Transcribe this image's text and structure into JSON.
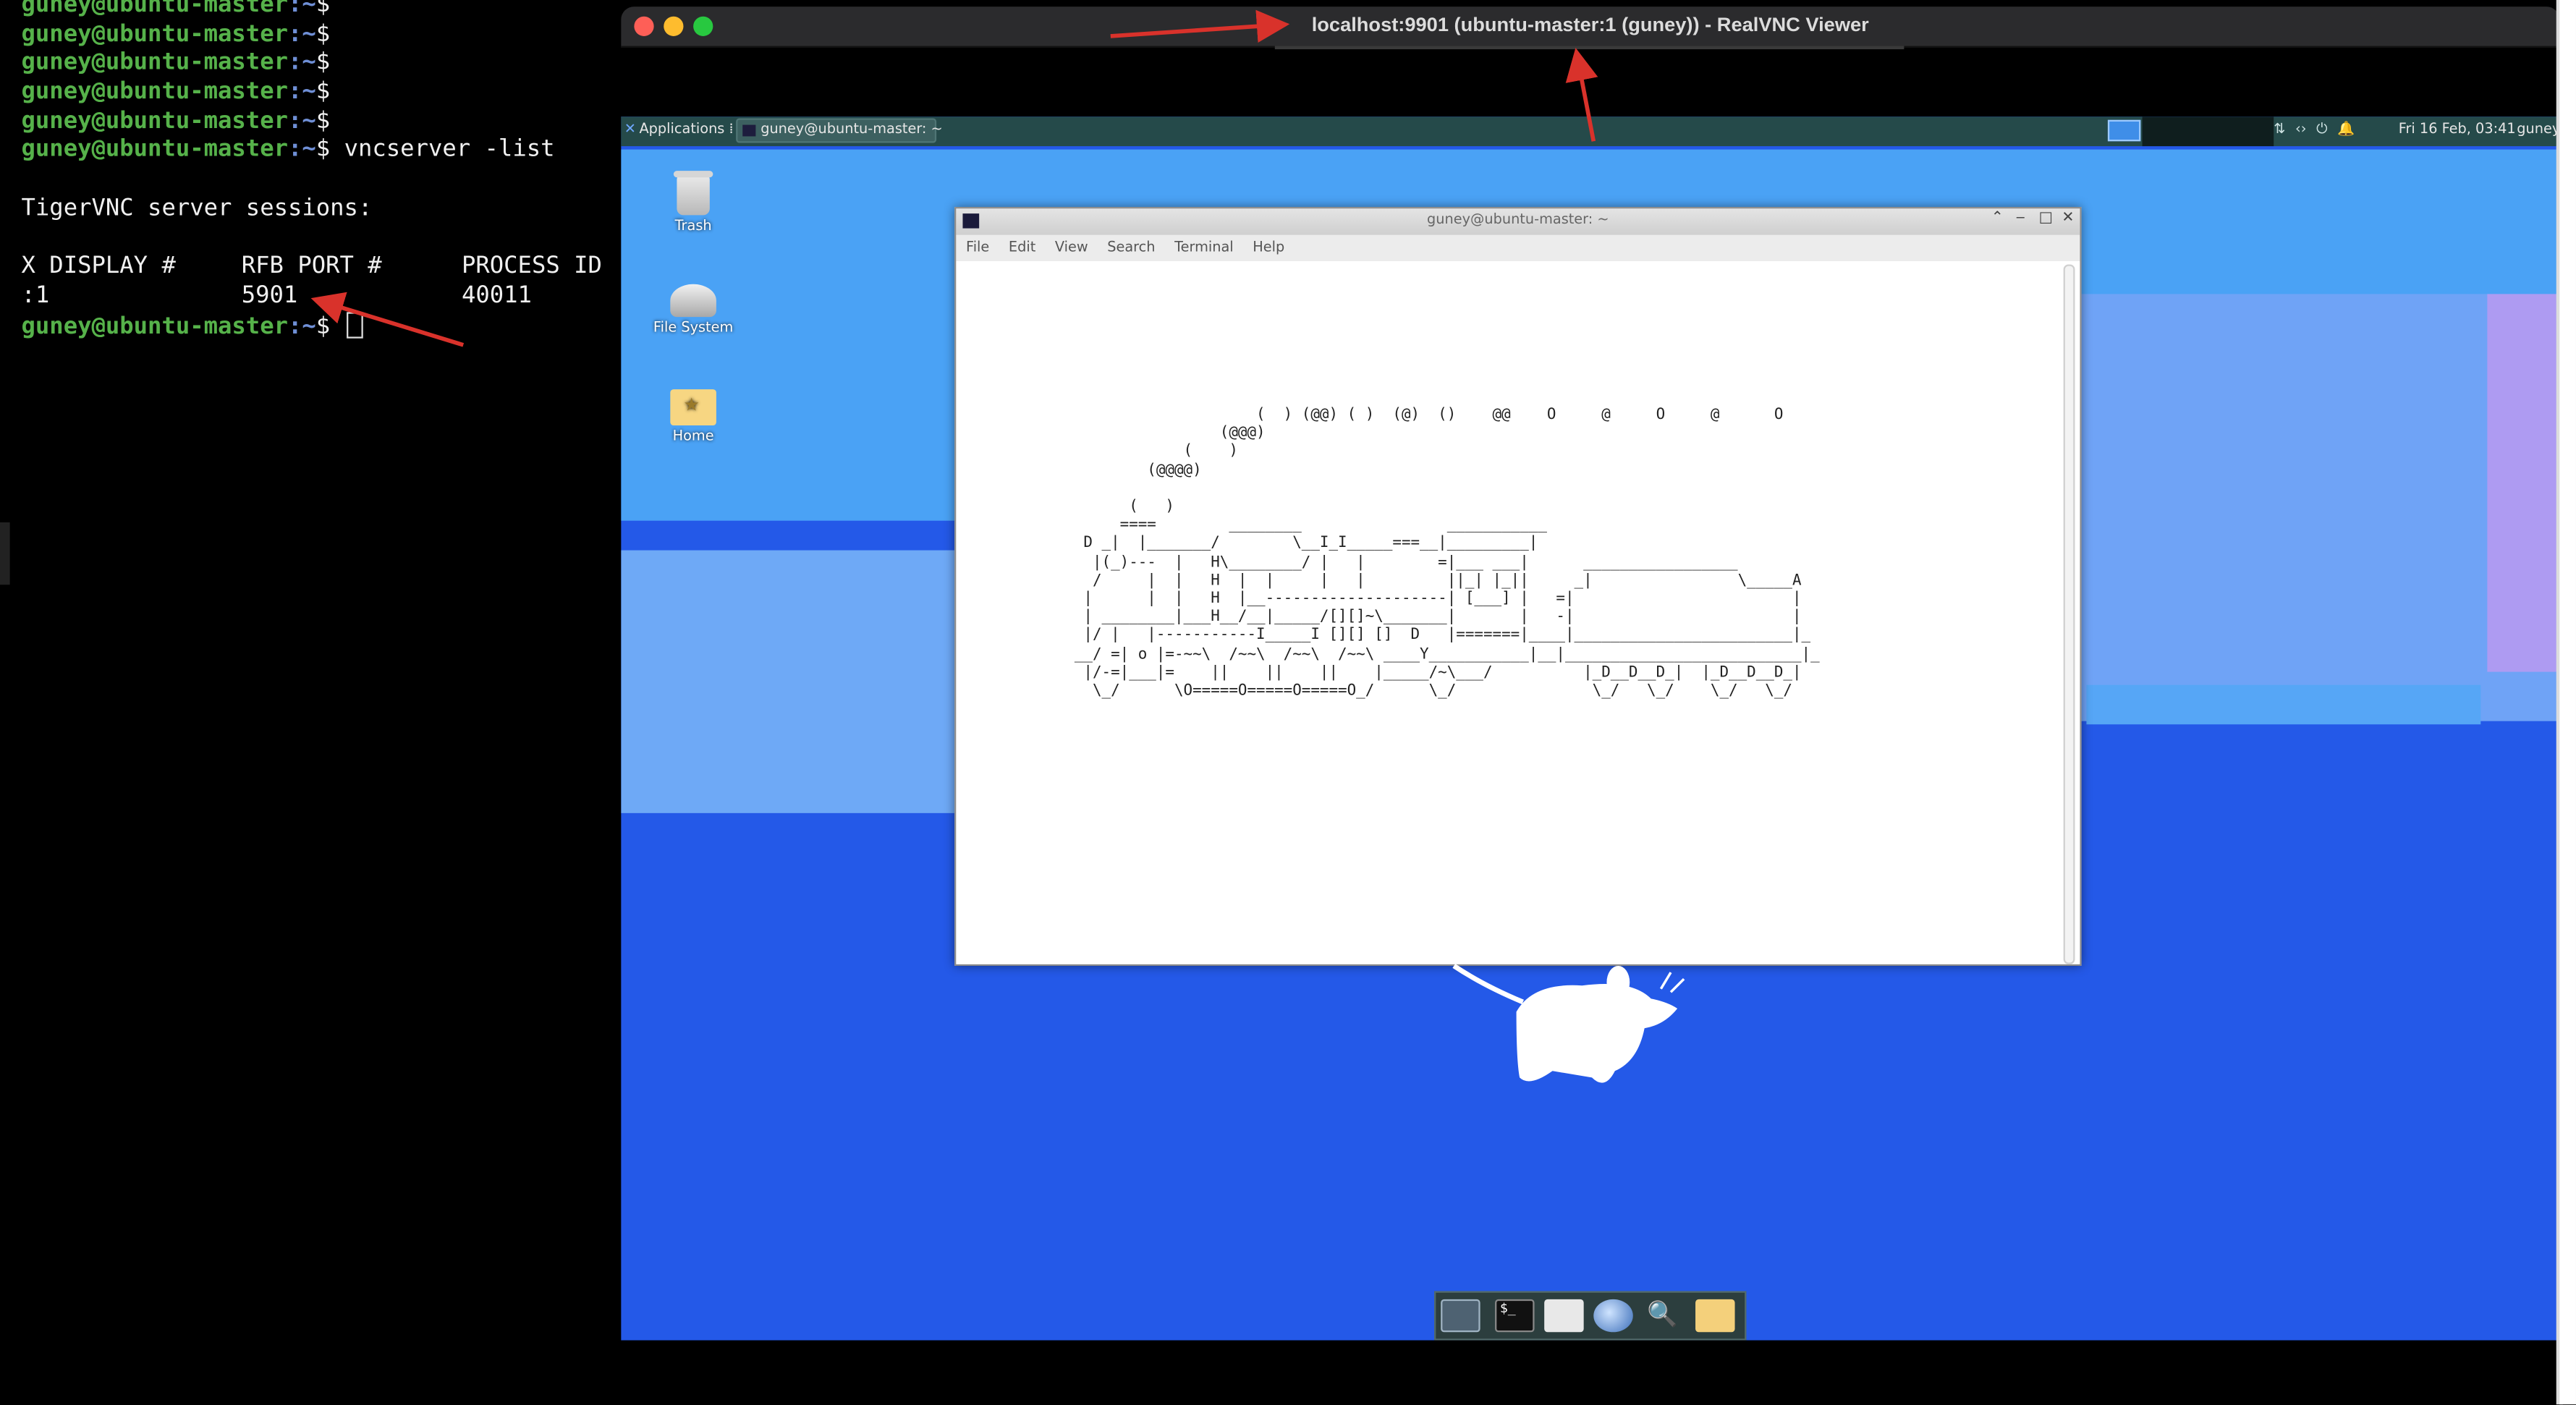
{
  "host_terminal": {
    "prompt_user": "guney@ubuntu-master",
    "prompt_path": ":~",
    "prompt_symbol": "$",
    "command": "vncserver -list",
    "sessions_heading": "TigerVNC server sessions:",
    "col_display": "X DISPLAY #",
    "col_port": "RFB PORT #",
    "col_pid": "PROCESS ID",
    "row_display": ":1",
    "row_port": "5901",
    "row_pid": "40011"
  },
  "vnc_viewer": {
    "title": "localhost:9901 (ubuntu-master:1 (guney)) - RealVNC Viewer",
    "panel": {
      "applications_label": "Applications",
      "task_label": "guney@ubuntu-master: ~",
      "clock": "Fri 16 Feb, 03:41",
      "user": "guney"
    },
    "desktop_icons": [
      "Trash",
      "File System",
      "Home"
    ],
    "terminal": {
      "title": "guney@ubuntu-master: ~",
      "menu": [
        "File",
        "Edit",
        "View",
        "Search",
        "Terminal",
        "Help"
      ],
      "art": "                    (  ) (@@) ( )  (@)  ()    @@    O     @     O     @      O\n                (@@@)\n            (    )\n        (@@@@)\n\n      (   )\n     ====        ________                ___________\n D _|  |_______/        \\__I_I_____===__|_________|\n  |(_)---  |   H\\________/ |   |        =|___ ___|      _________________\n  /     |  |   H  |  |     |   |         ||_| |_||     _|                \\_____A\n |      |  |   H  |__--------------------| [___] |   =|                        |\n | ________|___H__/__|_____/[][]~\\_______|       |   -|                        |\n |/ |   |-----------I_____I [][] []  D   |=======|____|________________________|_\n__/ =| o |=-~~\\  /~~\\  /~~\\  /~~\\ ____Y___________|__|__________________________|_\n |/-=|___|=    ||    ||    ||    |_____/~\\___/          |_D__D__D_|  |_D__D__D_|\n  \\_/      \\O=====O=====O=====O_/      \\_/               \\_/   \\_/    \\_/   \\_/"
    },
    "dock": [
      "desktop",
      "terminal",
      "files",
      "web-browser",
      "search",
      "folder"
    ]
  },
  "colors": {
    "prompt_green": "#56b24a",
    "prompt_blue": "#6f8fd6",
    "annotation_red": "#d9322b",
    "desktop_blue": "#2459e8"
  }
}
